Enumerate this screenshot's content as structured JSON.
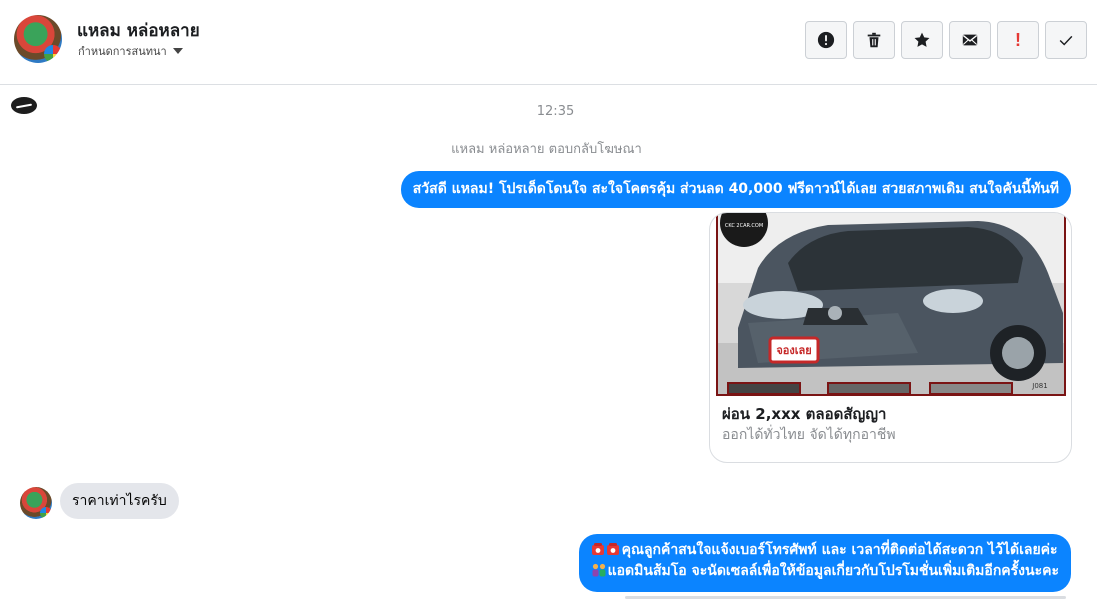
{
  "header": {
    "contact_name": "แหลม หล่อหลาย",
    "assign_label": "กำหนดการสนทนา"
  },
  "actions": [
    {
      "name": "alert-button",
      "icon": "exclamation-circle-icon"
    },
    {
      "name": "delete-button",
      "icon": "trash-icon"
    },
    {
      "name": "star-button",
      "icon": "star-icon"
    },
    {
      "name": "mark-unread-button",
      "icon": "envelope-icon"
    },
    {
      "name": "spam-button",
      "icon": "exclamation-icon",
      "label": "!"
    },
    {
      "name": "done-button",
      "icon": "checkmark-icon"
    }
  ],
  "thread": {
    "timestamp": "12:35",
    "ad_reply_note": "แหลม หล่อหลาย ตอบกลับโฆษณา",
    "greeting_message": "สวัสดี แหลม! โปรเด็ดโดนใจ สะใจโคตรคุ้ม ส่วนลด 40,000 ฟรีดาวน์ได้เลย สวยสภาพเดิม สนใจคันนี้ทันที",
    "ad_card": {
      "title": "ผ่อน 2,xxx ตลอดสัญญา",
      "subtitle": "ออกได้ทั่วไทย จัดได้ทุกอาชีพ",
      "image_watermark": "CKC 2CAR.COM",
      "image_stamp": "จองเลย",
      "image_code": "J081"
    },
    "customer_message": "ราคาเท่าไรครับ",
    "reply_line1": "คุณลูกค้าสนใจแจ้งเบอร์โทรศัพท์ และ เวลาที่ติดต่อได้สะดวก ไว้ได้เลยค่ะ",
    "reply_line2": "แอดมินส้มโอ จะนัดเซลล์เพื่อให้ข้อมูลเกี่ยวกับโปรโมชั่นเพิ่มเติมอีกครั้งนะคะ",
    "reply_line1_emoji": "phone-icons",
    "reply_line2_emoji": "people-icon"
  },
  "colors": {
    "accent": "#0b84ff",
    "incoming_bubble": "#e4e6eb",
    "muted_text": "#8a8d91",
    "danger": "#e53935"
  }
}
